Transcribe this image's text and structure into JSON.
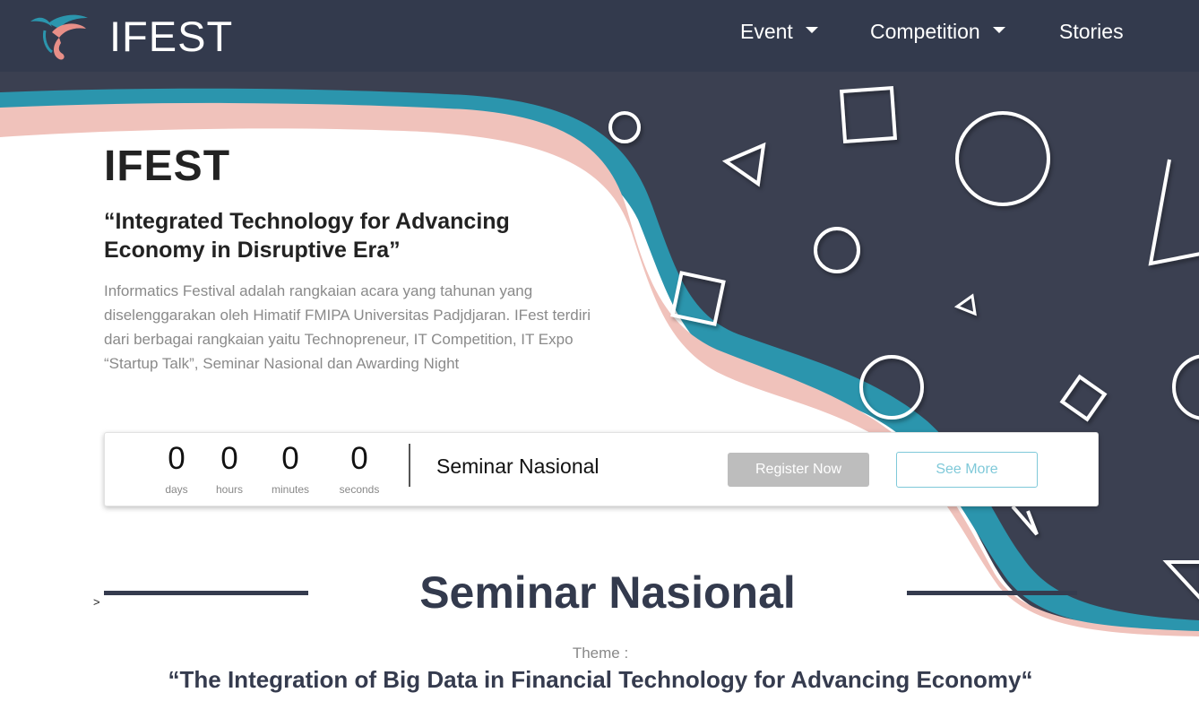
{
  "brand": {
    "name": "IFEST",
    "logo_icon": "ifest-wave-logo-icon"
  },
  "nav": {
    "items": [
      {
        "label": "Event",
        "dropdown": true
      },
      {
        "label": "Competition",
        "dropdown": true
      },
      {
        "label": "Stories",
        "dropdown": false
      }
    ]
  },
  "hero": {
    "title": "IFEST",
    "tagline": "“Integrated Technology for Advancing Economy in Disruptive Era”",
    "description": "Informatics Festival adalah rangkaian acara yang tahunan yang diselenggarakan oleh Himatif FMIPA Universitas Padjdjaran. IFest terdiri dari berbagai rangkaian yaitu Technopreneur, IT Competition, IT Expo “Startup Talk”, Seminar Nasional dan Awarding Night"
  },
  "countdown": {
    "days": {
      "value": "0",
      "label": "days"
    },
    "hours": {
      "value": "0",
      "label": "hours"
    },
    "minutes": {
      "value": "0",
      "label": "minutes"
    },
    "seconds": {
      "value": "0",
      "label": "seconds"
    },
    "event_name": "Seminar Nasional",
    "register_label": "Register Now",
    "see_more_label": "See More"
  },
  "seminar": {
    "marker": ">",
    "title": "Seminar Nasional",
    "theme_label": "Theme :",
    "theme_text": "“The Integration of Big Data in Financial Technology for Advancing Economy“"
  },
  "colors": {
    "navbar": "#333a4d",
    "hero_panel": "#3b4051",
    "wave_teal": "#2b95ad",
    "wave_pink": "#f0c2bb",
    "accent_outline": "#7fc9d9",
    "register_button": "#bdbdbd"
  }
}
